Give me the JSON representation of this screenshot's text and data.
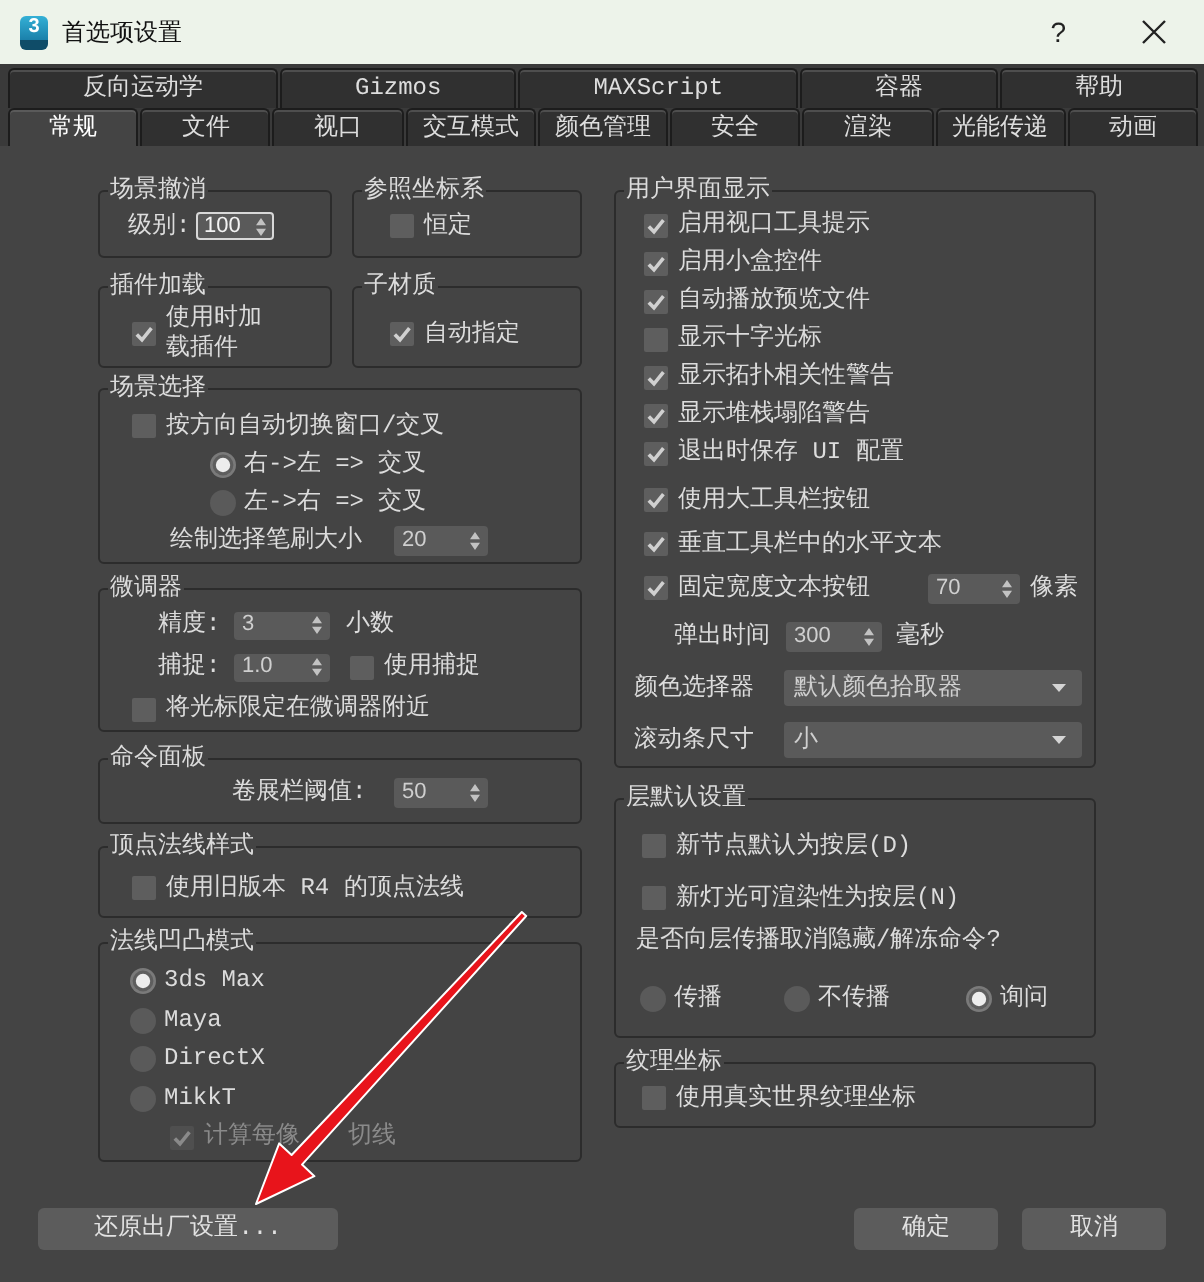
{
  "window": {
    "logo": "3",
    "title": "首选项设置",
    "help": "?"
  },
  "tabs": [
    [
      {
        "label": "反向运动学",
        "selected": false
      },
      {
        "label": "Gizmos",
        "selected": false
      },
      {
        "label": "MAXScript",
        "selected": false
      },
      {
        "label": "容器",
        "selected": false
      },
      {
        "label": "帮助",
        "selected": false
      }
    ],
    [
      {
        "label": "常规",
        "selected": true
      },
      {
        "label": "文件",
        "selected": false
      },
      {
        "label": "视口",
        "selected": false
      },
      {
        "label": "交互模式",
        "selected": false
      },
      {
        "label": "颜色管理",
        "selected": false
      },
      {
        "label": "安全",
        "selected": false
      },
      {
        "label": "渲染",
        "selected": false
      },
      {
        "label": "光能传递",
        "selected": false
      },
      {
        "label": "动画",
        "selected": false
      }
    ]
  ],
  "left_column": [
    [
      {
        "title": "场景撤消",
        "rows": [
          {
            "kind": "spinner",
            "label": "级别:",
            "value": "100",
            "focused": true
          }
        ]
      },
      {
        "title": "参照坐标系",
        "rows": [
          {
            "kind": "checkbox",
            "label": "恒定",
            "checked": false
          }
        ]
      }
    ],
    [
      {
        "title": "插件加载",
        "rows": [
          {
            "kind": "checkbox",
            "label": "使用时加载插件",
            "checked": true
          }
        ]
      },
      {
        "title": "子材质",
        "rows": [
          {
            "kind": "checkbox",
            "label": "自动指定",
            "checked": true
          }
        ]
      }
    ],
    [
      {
        "title": "场景选择",
        "rows": [
          {
            "kind": "checkbox",
            "label": "按方向自动切换窗口/交叉",
            "checked": false
          },
          {
            "kind": "radio",
            "label": "右->左 => 交叉",
            "selected": true
          },
          {
            "kind": "radio",
            "label": "左->右 => 交叉",
            "selected": false
          },
          {
            "kind": "spinner",
            "label": "绘制选择笔刷大小",
            "value": "20",
            "focused": false
          }
        ]
      }
    ],
    [
      {
        "title": "微调器",
        "rows": [
          {
            "kind": "spinner",
            "label": "精度:",
            "value": "3",
            "focused": false,
            "unit": "小数"
          },
          {
            "kind": "spinner",
            "label": "捕捉:",
            "value": "1.0",
            "focused": false,
            "checkbox": {
              "label": "使用捕捉",
              "checked": false
            }
          },
          {
            "kind": "checkbox",
            "label": "将光标限定在微调器附近",
            "checked": false
          }
        ]
      }
    ],
    [
      {
        "title": "命令面板",
        "rows": [
          {
            "kind": "spinner",
            "label": "卷展栏阈值:",
            "value": "50",
            "focused": false
          }
        ]
      }
    ],
    [
      {
        "title": "顶点法线样式",
        "rows": [
          {
            "kind": "checkbox",
            "label": "使用旧版本 R4 的顶点法线",
            "checked": false
          }
        ]
      }
    ],
    [
      {
        "title": "法线凹凸模式",
        "rows": [
          {
            "kind": "radio",
            "label": "3ds Max",
            "selected": true,
            "disabled": false
          },
          {
            "kind": "radio",
            "label": "Maya",
            "selected": false,
            "disabled": false
          },
          {
            "kind": "radio",
            "label": "DirectX",
            "selected": false,
            "disabled": false
          },
          {
            "kind": "radio",
            "label": "MikkT",
            "selected": false,
            "disabled": false
          },
          {
            "kind": "checkbox",
            "label": "计算每像",
            "label_continued": "切线",
            "checked": true,
            "disabled": true
          }
        ]
      }
    ]
  ],
  "right_column": [
    [
      {
        "title": "用户界面显示",
        "rows": [
          {
            "kind": "checkbox",
            "label": "启用视口工具提示",
            "checked": true
          },
          {
            "kind": "checkbox",
            "label": "启用小盒控件",
            "checked": true
          },
          {
            "kind": "checkbox",
            "label": "自动播放预览文件",
            "checked": true
          },
          {
            "kind": "checkbox",
            "label": "显示十字光标",
            "checked": false
          },
          {
            "kind": "checkbox",
            "label": "显示拓扑相关性警告",
            "checked": true
          },
          {
            "kind": "checkbox",
            "label": "显示堆栈塌陷警告",
            "checked": true
          },
          {
            "kind": "checkbox",
            "label": "退出时保存 UI 配置",
            "checked": true
          },
          {
            "kind": "checkbox",
            "label": "使用大工具栏按钮",
            "checked": true
          },
          {
            "kind": "checkbox",
            "label": "垂直工具栏中的水平文本",
            "checked": true
          },
          {
            "kind": "checkbox",
            "label": "固定宽度文本按钮",
            "checked": true,
            "spinner": {
              "value": "70",
              "focused": false,
              "unit": "像素"
            }
          },
          {
            "kind": "spinner",
            "label": "弹出时间",
            "value": "300",
            "focused": false,
            "unit": "毫秒"
          },
          {
            "kind": "dropdown",
            "label": "颜色选择器",
            "value": "默认颜色拾取器"
          },
          {
            "kind": "dropdown",
            "label": "滚动条尺寸",
            "value": "小"
          }
        ]
      }
    ],
    [
      {
        "title": "层默认设置",
        "rows": [
          {
            "kind": "checkbox",
            "label": "新节点默认为按层(D)",
            "checked": false
          },
          {
            "kind": "checkbox",
            "label": "新灯光可渲染性为按层(N)",
            "checked": false
          },
          {
            "kind": "text",
            "text": "是否向层传播取消隐藏/解冻命令?"
          },
          {
            "kind": "radio_group",
            "options": [
              {
                "label": "传播",
                "selected": false
              },
              {
                "label": "不传播",
                "selected": false
              },
              {
                "label": "询问",
                "selected": true
              }
            ]
          }
        ]
      }
    ],
    [
      {
        "title": "纹理坐标",
        "rows": [
          {
            "kind": "checkbox",
            "label": "使用真实世界纹理坐标",
            "checked": false
          }
        ]
      }
    ]
  ],
  "footer": {
    "left_buttons": [
      "还原出厂设置..."
    ],
    "right_buttons": [
      "确定",
      "取消"
    ]
  },
  "annotations": [
    {
      "kind": "arrow"
    }
  ]
}
